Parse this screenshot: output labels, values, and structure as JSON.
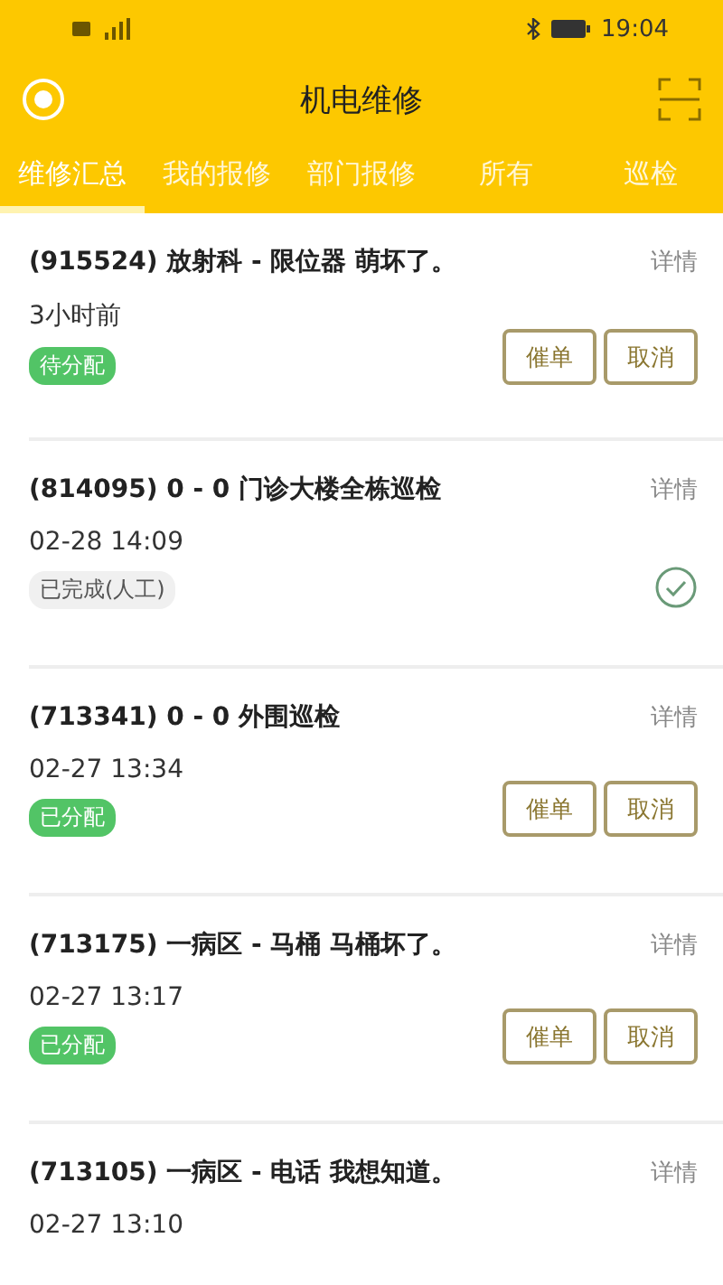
{
  "status_bar": {
    "time": "19:04"
  },
  "header": {
    "title": "机电维修"
  },
  "tabs": [
    {
      "label": "维修汇总",
      "selected": true
    },
    {
      "label": "我的报修",
      "selected": false
    },
    {
      "label": "部门报修",
      "selected": false
    },
    {
      "label": "所有",
      "selected": false
    },
    {
      "label": "巡检",
      "selected": false
    }
  ],
  "orders": [
    {
      "title": "(915524) 放射科 - 限位器 萌坏了。",
      "detail": "详情",
      "time": "3小时前",
      "status": {
        "label": "待分配",
        "kind": "open"
      },
      "kind": "actions",
      "actions": [
        "催单",
        "取消"
      ]
    },
    {
      "title": "(814095) 0 - 0 门诊大楼全栋巡检",
      "detail": "详情",
      "time": "02-28 14:09",
      "status": {
        "label": "已完成(人工)",
        "kind": "done"
      },
      "kind": "completed"
    },
    {
      "title": "(713341) 0 - 0 外围巡检",
      "detail": "详情",
      "time": "02-27 13:34",
      "status": {
        "label": "已分配",
        "kind": "open"
      },
      "kind": "actions",
      "actions": [
        "催单",
        "取消"
      ]
    },
    {
      "title": "(713175) 一病区 - 马桶 马桶坏了。",
      "detail": "详情",
      "time": "02-27 13:17",
      "status": {
        "label": "已分配",
        "kind": "open"
      },
      "kind": "actions",
      "actions": [
        "催单",
        "取消"
      ]
    },
    {
      "title": "(713105) 一病区 - 电话 我想知道。",
      "detail": "详情",
      "time": "02-27 13:10"
    }
  ]
}
